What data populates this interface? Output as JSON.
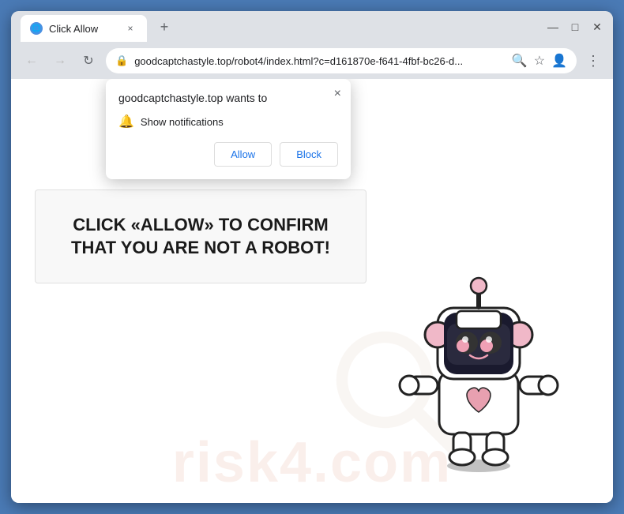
{
  "browser": {
    "tab": {
      "favicon": "🌐",
      "title": "Click Allow",
      "close_label": "×"
    },
    "new_tab_label": "+",
    "window_controls": {
      "minimize": "—",
      "maximize": "□",
      "close": "✕"
    },
    "address_bar": {
      "url": "goodcaptchastyle.top/robot4/index.html?c=d161870e-f641-4fbf-bc26-d...",
      "back_icon": "←",
      "forward_icon": "→",
      "refresh_icon": "↻",
      "lock_icon": "🔒",
      "search_icon": "🔍",
      "bookmark_icon": "☆",
      "profile_icon": "👤",
      "menu_icon": "⋮"
    }
  },
  "notification_popup": {
    "site_name": "goodcaptchastyle.top wants to",
    "close_label": "×",
    "notification_row": {
      "bell_icon": "🔔",
      "text": "Show notifications"
    },
    "allow_label": "Allow",
    "block_label": "Block"
  },
  "page": {
    "captcha_text": "CLICK «ALLOW» TO CONFIRM THAT YOU ARE NOT A ROBOT!",
    "watermark": "risk4.com"
  }
}
